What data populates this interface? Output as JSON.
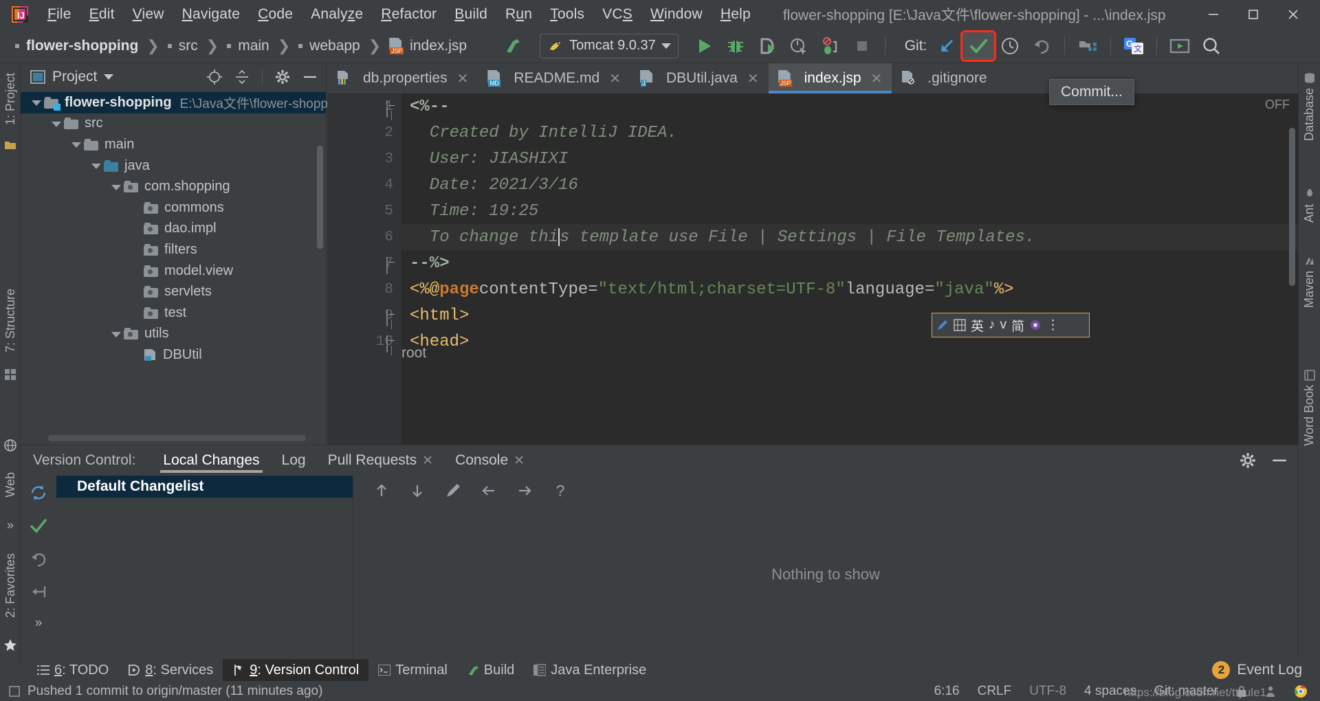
{
  "window": {
    "title": "flower-shopping [E:\\Java文件\\flower-shopping] - ...\\index.jsp",
    "minimize": "–",
    "maximize": "□",
    "close": "✕"
  },
  "menu": [
    {
      "label": "File",
      "mnemonic": "F"
    },
    {
      "label": "Edit",
      "mnemonic": "E"
    },
    {
      "label": "View",
      "mnemonic": "V"
    },
    {
      "label": "Navigate",
      "mnemonic": "N"
    },
    {
      "label": "Code",
      "mnemonic": "C"
    },
    {
      "label": "Analyze",
      "mnemonic": "z"
    },
    {
      "label": "Refactor",
      "mnemonic": "R"
    },
    {
      "label": "Build",
      "mnemonic": "B"
    },
    {
      "label": "Run",
      "mnemonic": "u"
    },
    {
      "label": "Tools",
      "mnemonic": "T"
    },
    {
      "label": "VCS",
      "mnemonic": "S"
    },
    {
      "label": "Window",
      "mnemonic": "W"
    },
    {
      "label": "Help",
      "mnemonic": "H"
    }
  ],
  "navbar": {
    "crumbs": [
      {
        "label": "flower-shopping"
      },
      {
        "label": "src"
      },
      {
        "label": "main"
      },
      {
        "label": "webapp"
      },
      {
        "label": "index.jsp"
      }
    ],
    "separator": "❯",
    "run_config": {
      "name": "Tomcat 9.0.37",
      "icon": "tomcat-icon"
    },
    "git_label": "Git:",
    "icons": [
      "build-icon",
      "run-icon",
      "debug-icon",
      "run-coverage-icon",
      "profile-icon",
      "stop-icon",
      "update-project-icon",
      "commit-icon",
      "history-icon",
      "rollback-icon",
      "project-structure-icon",
      "google-translate-icon",
      "present-icon",
      "search-everywhere-icon"
    ]
  },
  "tooltip": {
    "text": "Commit..."
  },
  "left_strip": {
    "top_labels": [
      "1: Project"
    ],
    "mid_labels": [
      "7: Structure"
    ],
    "bottom_labels": [
      "2: Favorites",
      "Web"
    ],
    "overflow": "»"
  },
  "right_strip": {
    "labels": [
      "Database",
      "Ant",
      "Maven",
      "Word Book"
    ]
  },
  "project_panel": {
    "title": "Project",
    "header_icons": [
      "locate-icon",
      "collapse-all-icon",
      "gear-icon",
      "hide-icon"
    ],
    "tree": [
      {
        "label": "flower-shopping",
        "path": "E:\\Java文件\\flower-shopping",
        "depth": 0,
        "twisty": "open",
        "bold": true,
        "selected": true,
        "icon": "module-folder-icon"
      },
      {
        "label": "src",
        "depth": 1,
        "twisty": "open",
        "icon": "folder-icon"
      },
      {
        "label": "main",
        "depth": 2,
        "twisty": "open",
        "icon": "folder-icon"
      },
      {
        "label": "java",
        "depth": 3,
        "twisty": "open",
        "icon": "source-folder-icon"
      },
      {
        "label": "com.shopping",
        "depth": 4,
        "twisty": "open",
        "icon": "package-icon"
      },
      {
        "label": "commons",
        "depth": 5,
        "twisty": "none",
        "icon": "package-icon"
      },
      {
        "label": "dao.impl",
        "depth": 5,
        "twisty": "none",
        "icon": "package-icon"
      },
      {
        "label": "filters",
        "depth": 5,
        "twisty": "none",
        "icon": "package-icon"
      },
      {
        "label": "model.view",
        "depth": 5,
        "twisty": "none",
        "icon": "package-icon"
      },
      {
        "label": "servlets",
        "depth": 5,
        "twisty": "none",
        "icon": "package-icon"
      },
      {
        "label": "test",
        "depth": 5,
        "twisty": "none",
        "icon": "package-icon"
      },
      {
        "label": "utils",
        "depth": 4,
        "twisty": "open",
        "icon": "package-icon"
      },
      {
        "label": "DBUtil",
        "depth": 5,
        "twisty": "none",
        "icon": "java-class-icon"
      }
    ]
  },
  "editor": {
    "tabs": [
      {
        "label": "db.properties",
        "badge": "",
        "icon": "properties-file-icon",
        "active": false,
        "closable": true
      },
      {
        "label": "README.md",
        "badge": "MD",
        "icon": "markdown-file-icon",
        "active": false,
        "closable": true
      },
      {
        "label": "DBUtil.java",
        "badge": "J",
        "icon": "java-file-icon",
        "active": false,
        "closable": true
      },
      {
        "label": "index.jsp",
        "badge": "JSP",
        "icon": "jsp-file-icon",
        "active": true,
        "closable": true
      },
      {
        "label": ".gitignore",
        "badge": "",
        "icon": "gitignore-file-icon",
        "active": false,
        "closable": false
      }
    ],
    "inspection_state": "OFF",
    "breadcrumb_bottom": "root",
    "line_numbers": [
      1,
      2,
      3,
      4,
      5,
      6,
      7,
      8,
      9,
      10
    ],
    "caret_line": 6,
    "lines": [
      {
        "n": 1,
        "text": "<%--",
        "kind": "comment-bold",
        "fold": "start"
      },
      {
        "n": 2,
        "text": "  Created by IntelliJ IDEA.",
        "kind": "comment"
      },
      {
        "n": 3,
        "text": "  User: JIASHIXI",
        "kind": "comment"
      },
      {
        "n": 4,
        "text": "  Date: 2021/3/16",
        "kind": "comment"
      },
      {
        "n": 5,
        "text": "  Time: 19:25",
        "kind": "comment"
      },
      {
        "n": 6,
        "text": "  To change this template use File | Settings | File Templates.",
        "kind": "comment"
      },
      {
        "n": 7,
        "text": "--%>",
        "kind": "comment-bold",
        "fold": "end"
      },
      {
        "n": 8,
        "text": "<%@ page contentType=\"text/html;charset=UTF-8\" language=\"java\" %>",
        "kind": "directive"
      },
      {
        "n": 9,
        "text": "<html>",
        "kind": "tag",
        "fold": "start"
      },
      {
        "n": 10,
        "text": "<head>",
        "kind": "tag",
        "fold": "start"
      }
    ]
  },
  "ime": {
    "items": [
      "ime-pen-icon",
      "ime-grid-icon",
      "英",
      "♪",
      "v",
      "",
      "简",
      "ime-settings-icon",
      "⋮"
    ]
  },
  "version_control": {
    "label": "Version Control:",
    "tabs": [
      {
        "label": "Local Changes",
        "active": true,
        "closable": false
      },
      {
        "label": "Log",
        "active": false,
        "closable": false
      },
      {
        "label": "Pull Requests",
        "active": false,
        "closable": true
      },
      {
        "label": "Console",
        "active": false,
        "closable": true
      }
    ],
    "header_icons": [
      "gear-icon",
      "hide-icon"
    ],
    "rail_icons": [
      "refresh-icon",
      "commit-check-icon",
      "rollback-icon",
      "shelve-icon",
      "more-icon"
    ],
    "changelist": "Default Changelist",
    "toolbar_icons": [
      "up-arrow-icon",
      "down-arrow-icon",
      "edit-icon",
      "left-arrow-icon",
      "right-arrow-icon",
      "help-icon"
    ],
    "empty_message": "Nothing to show"
  },
  "bottom_tabs": [
    {
      "num": "6",
      "label": ": TODO",
      "icon": "todo-icon",
      "active": false
    },
    {
      "num": "8",
      "label": ": Services",
      "icon": "services-icon",
      "active": false
    },
    {
      "num": "9",
      "label": ": Version Control",
      "icon": "vcs-icon",
      "active": true
    },
    {
      "num": "",
      "label": "Terminal",
      "icon": "terminal-icon",
      "active": false
    },
    {
      "num": "",
      "label": "Build",
      "icon": "build-icon",
      "active": false
    },
    {
      "num": "",
      "label": "Java Enterprise",
      "icon": "java-enterprise-icon",
      "active": false
    }
  ],
  "event_log": {
    "label": "Event Log",
    "count": "2"
  },
  "status_bar": {
    "message": "Pushed 1 commit to origin/master (11 minutes ago)",
    "caret_position": "6:16",
    "line_separator": "CRLF",
    "encoding": "UTF-8",
    "indent": "4 spaces",
    "branch": "Git: master",
    "watermark": "https://blog.csdn.net/ttyule1"
  },
  "colors": {
    "accent_blue": "#4a88c7",
    "selection_blue": "#0d293e",
    "highlight_red": "#ff2a17",
    "git_green": "#59a869",
    "badge_orange": "#e8a33d",
    "editor_bg": "#2b2b2b",
    "panel_bg": "#3c3f41"
  }
}
